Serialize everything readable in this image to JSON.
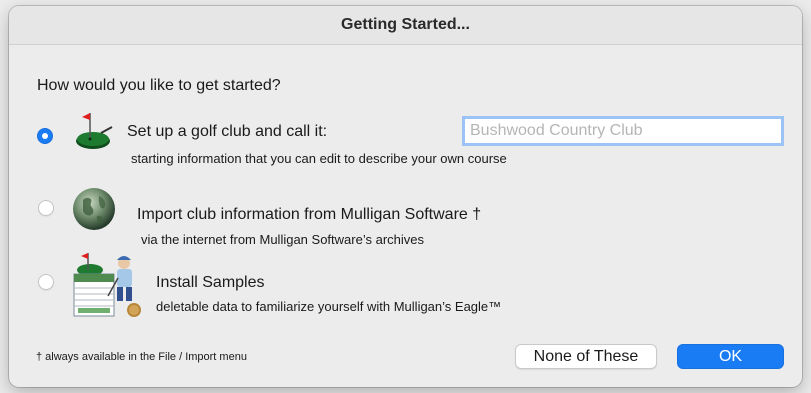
{
  "dialog": {
    "title": "Getting Started..."
  },
  "prompt": "How would you like to get started?",
  "options": [
    {
      "label": "Set up a golf club and call it:",
      "description": "starting information that you can edit to describe your own course",
      "selected": true,
      "icon": "golf-green-flag-icon"
    },
    {
      "label": "Import club information from Mulligan Software †",
      "description": "via the internet from Mulligan Software’s archives",
      "selected": false,
      "icon": "globe-icon"
    },
    {
      "label": "Install Samples",
      "description": "deletable data to familiarize yourself with Mulligan’s Eagle™",
      "selected": false,
      "icon": "samples-golfer-icon"
    }
  ],
  "club_name_input": {
    "value": "",
    "placeholder": "Bushwood Country Club"
  },
  "footnote": "† always available in the File / Import menu",
  "buttons": {
    "none_label": "None of These",
    "ok_label": "OK"
  },
  "colors": {
    "accent": "#1a7cf5",
    "focus_ring": "#9cc3f5"
  }
}
